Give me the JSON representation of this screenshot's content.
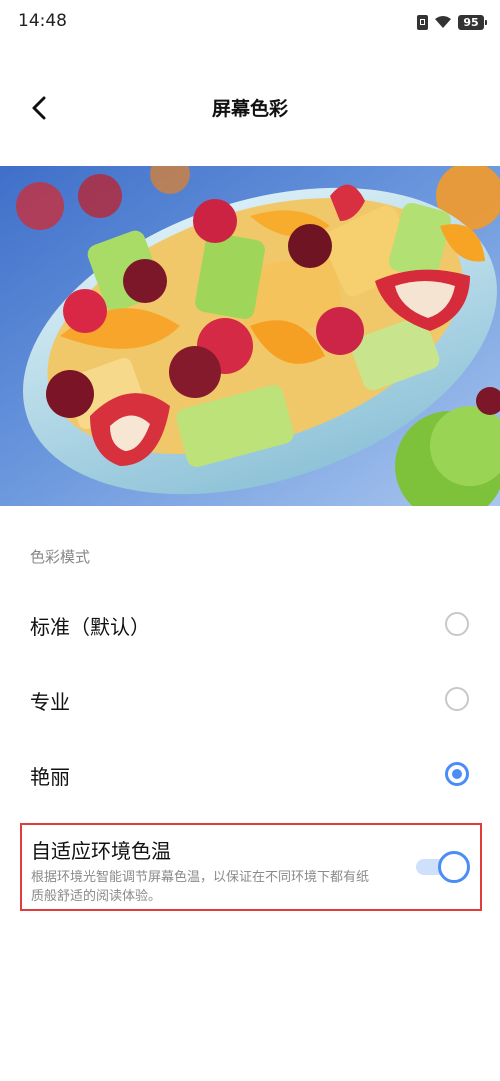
{
  "status_bar": {
    "time": "14:48",
    "battery": "95",
    "icons": [
      "sim-icon",
      "wifi-icon",
      "battery-icon"
    ]
  },
  "header": {
    "title": "屏幕色彩",
    "back_icon": "chevron-left-icon"
  },
  "preview": {
    "image": "fruit-salad-bowl"
  },
  "color_mode": {
    "section_title": "色彩模式",
    "options": [
      {
        "label": "标准（默认）",
        "selected": false
      },
      {
        "label": "专业",
        "selected": false
      },
      {
        "label": "艳丽",
        "selected": true
      }
    ]
  },
  "adaptive": {
    "title": "自适应环境色温",
    "description": "根据环境光智能调节屏幕色温，以保证在不同环境下都有纸质般舒适的阅读体验。",
    "enabled": true
  },
  "colors": {
    "accent": "#4a8df6",
    "highlight_border": "#e23b3b"
  }
}
